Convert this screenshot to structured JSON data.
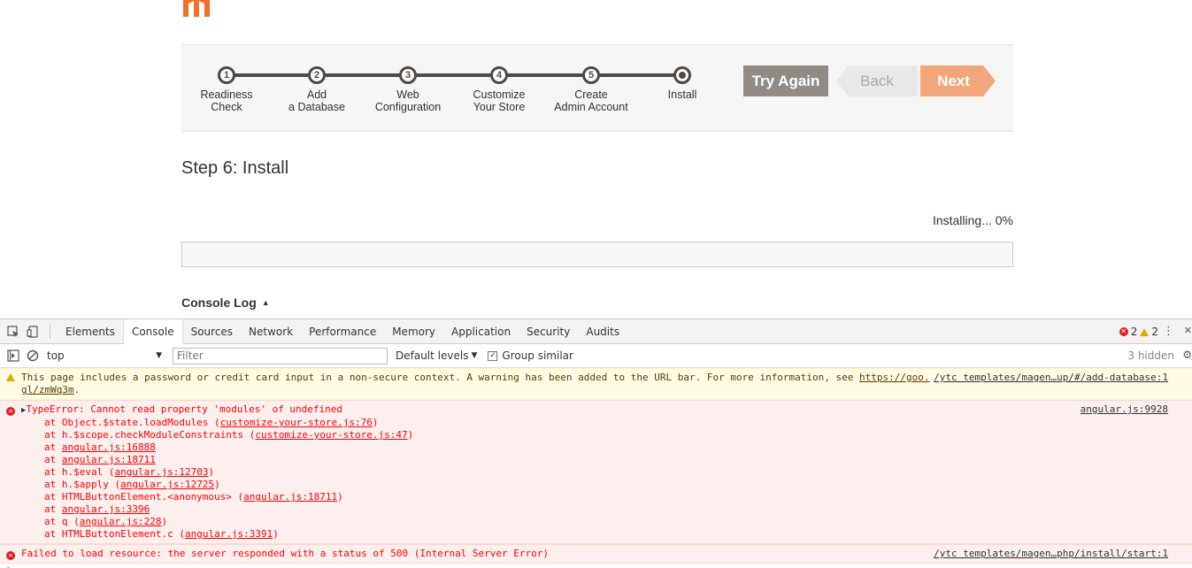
{
  "wizard": {
    "steps": [
      {
        "num": "1",
        "label": "Readiness\nCheck"
      },
      {
        "num": "2",
        "label": "Add\na Database"
      },
      {
        "num": "3",
        "label": "Web\nConfiguration"
      },
      {
        "num": "4",
        "label": "Customize\nYour Store"
      },
      {
        "num": "5",
        "label": "Create\nAdmin Account"
      },
      {
        "num": "",
        "label": "Install"
      }
    ],
    "buttons": {
      "try_again": "Try Again",
      "back": "Back",
      "next": "Next"
    }
  },
  "main": {
    "step_title": "Step 6: Install",
    "install_status": "Installing... 0%",
    "progress_percent": 0,
    "console_log_label": "Console Log"
  },
  "devtools": {
    "tabs": [
      "Elements",
      "Console",
      "Sources",
      "Network",
      "Performance",
      "Memory",
      "Application",
      "Security",
      "Audits"
    ],
    "active_tab": "Console",
    "error_count": "2",
    "warning_count": "2",
    "context": "top",
    "filter_placeholder": "Filter",
    "levels_label": "Default levels",
    "group_similar_label": "Group similar",
    "hidden_count": "3 hidden",
    "messages": {
      "warning_text": "This page includes a password or credit card input in a non-secure context. A warning has been added to the URL bar. For more information, see ",
      "warning_link": "https://goo.",
      "warning_source": "/ytc templates/magen…up/#/add-database:1",
      "warning_link_cont": "gl/zmWq3m",
      "warning_tail": ".",
      "error1_title": "TypeError: Cannot read property 'modules' of undefined",
      "error1_source": "angular.js:9928",
      "trace": [
        {
          "pre": "at Object.$state.loadModules (",
          "link": "customize-your-store.js:76",
          "post": ")"
        },
        {
          "pre": "at h.$scope.checkModuleConstraints (",
          "link": "customize-your-store.js:47",
          "post": ")"
        },
        {
          "pre": "at ",
          "link": "angular.js:16888",
          "post": ""
        },
        {
          "pre": "at ",
          "link": "angular.js:18711",
          "post": ""
        },
        {
          "pre": "at h.$eval (",
          "link": "angular.js:12703",
          "post": ")"
        },
        {
          "pre": "at h.$apply (",
          "link": "angular.js:12725",
          "post": ")"
        },
        {
          "pre": "at HTMLButtonElement.<anonymous> (",
          "link": "angular.js:18711",
          "post": ")"
        },
        {
          "pre": "at ",
          "link": "angular.js:3396",
          "post": ""
        },
        {
          "pre": "at q (",
          "link": "angular.js:228",
          "post": ")"
        },
        {
          "pre": "at HTMLButtonElement.c (",
          "link": "angular.js:3391",
          "post": ")"
        }
      ],
      "error2_text": "Failed to load resource: the server responded with a status of 500 (Internal Server Error)",
      "error2_source": "/ytc templates/magen…php/install/start:1"
    },
    "prompt_symbol": ">"
  },
  "colors": {
    "magento_orange": "#f46f25",
    "next_button": "#f3a679",
    "try_again_button": "#928b85",
    "step_dark": "#514943",
    "error_red": "#ff0000",
    "warning_bg": "#fffbe5"
  }
}
